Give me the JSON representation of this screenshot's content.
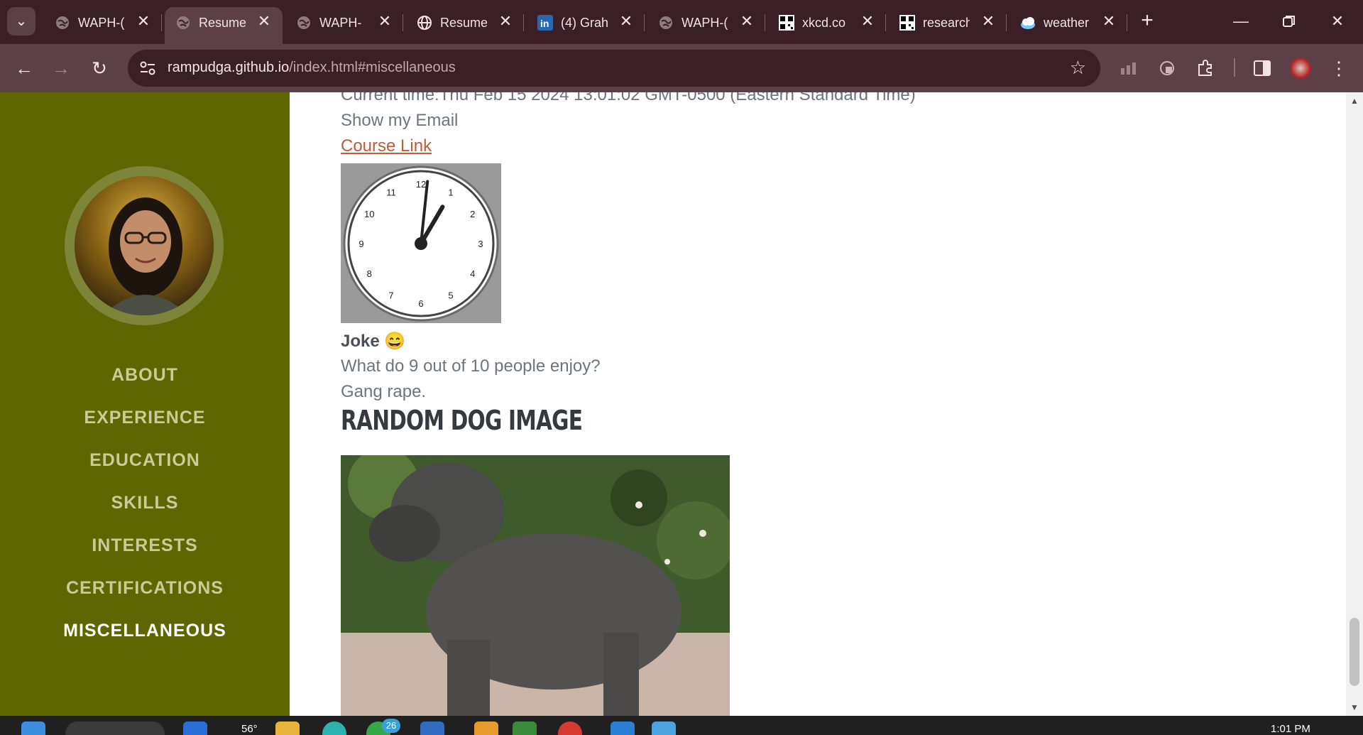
{
  "browser": {
    "tabs": [
      {
        "label": "WAPH-(",
        "icon": "globe-icon",
        "active": false
      },
      {
        "label": "Resume",
        "icon": "globe-icon",
        "active": true
      },
      {
        "label": "WAPH-",
        "icon": "globe-icon",
        "active": false
      },
      {
        "label": "Resume",
        "icon": "www-globe-icon",
        "active": false
      },
      {
        "label": "(4) Grah",
        "icon": "linkedin-icon",
        "active": false
      },
      {
        "label": "WAPH-(",
        "icon": "globe-icon",
        "active": false
      },
      {
        "label": "xkcd.co",
        "icon": "xkcd-icon",
        "active": false
      },
      {
        "label": "research",
        "icon": "xkcd-icon",
        "active": false
      },
      {
        "label": "weather",
        "icon": "weather-icon",
        "active": false
      }
    ],
    "new_tab_label": "+",
    "close_glyph": "✕",
    "address": {
      "host": "rampudga.github.io",
      "path": "/index.html#miscellaneous"
    }
  },
  "sidebar": {
    "nav": [
      {
        "label": "About",
        "active": false
      },
      {
        "label": "Experience",
        "active": false
      },
      {
        "label": "Education",
        "active": false
      },
      {
        "label": "Skills",
        "active": false
      },
      {
        "label": "Interests",
        "active": false
      },
      {
        "label": "Certifications",
        "active": false
      },
      {
        "label": "Miscellaneous",
        "active": true
      }
    ]
  },
  "content": {
    "current_time": "Current time:Thu Feb 15 2024 13:01:02 GMT-0500 (Eastern Standard Time)",
    "show_email": "Show my Email",
    "course_link": "Course Link",
    "clock": {
      "numbers": [
        "12",
        "1",
        "2",
        "3",
        "4",
        "5",
        "6",
        "7",
        "8",
        "9",
        "10",
        "11"
      ],
      "hour": 1,
      "minute": 1
    },
    "joke_title": "Joke",
    "joke_emoji": "😄",
    "joke_question": "What do 9 out of 10 people enjoy?",
    "joke_answer": "Gang rape.",
    "dog_heading": "Random Dog Image"
  },
  "taskbar": {
    "temperature": "56°",
    "badge_count": "26",
    "time": "1:01 PM"
  },
  "colors": {
    "sidebar_bg": "#5d6600",
    "nav_text": "#c9cc95",
    "nav_active": "#ffffff",
    "link": "#bd5d38",
    "chrome_dark": "#3a1f27",
    "chrome_mid": "#5c3f47"
  }
}
